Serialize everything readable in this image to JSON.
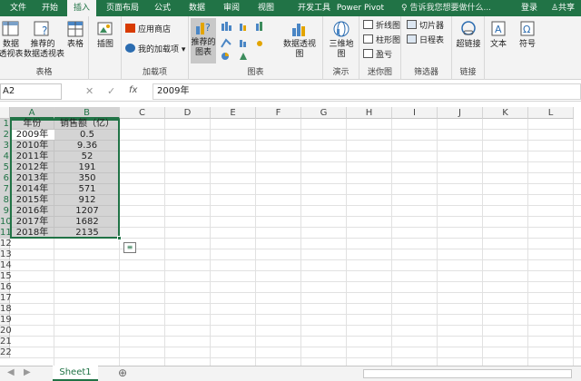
{
  "tabs": [
    "文件",
    "开始",
    "插入",
    "页面布局",
    "公式",
    "数据",
    "审阅",
    "视图",
    "开发工具",
    "Power Pivot"
  ],
  "tell_me": "告诉我您想要做什么...",
  "login": "登录",
  "share": "共享",
  "ribbon": {
    "pivot": "数据\n透视表",
    "rec_pivot": "推荐的\n数据透视表",
    "table": "表格",
    "illus": "插图",
    "store": "应用商店",
    "myaddins": "我的加载项",
    "rec_charts": "推荐的\n图表",
    "pivotchart": "数据透视图",
    "map3d": "三维地\n图",
    "line": "折线图",
    "column": "柱形图",
    "winloss": "盈亏",
    "slicer": "切片器",
    "timeline": "日程表",
    "hyperlink": "超链接",
    "text": "文本",
    "symbol": "符号",
    "g_tables": "表格",
    "g_addins": "加载项",
    "g_charts": "图表",
    "g_tours": "演示",
    "g_spark": "迷你图",
    "g_filter": "筛选器",
    "g_links": "链接"
  },
  "accent": "#217346",
  "namebox": "A2",
  "formula": "2009年",
  "columns": [
    "A",
    "B",
    "C",
    "D",
    "E",
    "F",
    "G",
    "H",
    "I",
    "J",
    "K",
    "L"
  ],
  "rows": [
    "1",
    "2",
    "3",
    "4",
    "5",
    "6",
    "7",
    "8",
    "9",
    "10",
    "11",
    "12",
    "13",
    "14",
    "15",
    "16",
    "17",
    "18",
    "19",
    "20",
    "21",
    "22"
  ],
  "header": [
    "年份",
    "销售额（亿）"
  ],
  "data": [
    [
      "2009年",
      "0.5"
    ],
    [
      "2010年",
      "9.36"
    ],
    [
      "2011年",
      "52"
    ],
    [
      "2012年",
      "191"
    ],
    [
      "2013年",
      "350"
    ],
    [
      "2014年",
      "571"
    ],
    [
      "2015年",
      "912"
    ],
    [
      "2016年",
      "1207"
    ],
    [
      "2017年",
      "1682"
    ],
    [
      "2018年",
      "2135"
    ]
  ],
  "sheet": "Sheet1"
}
